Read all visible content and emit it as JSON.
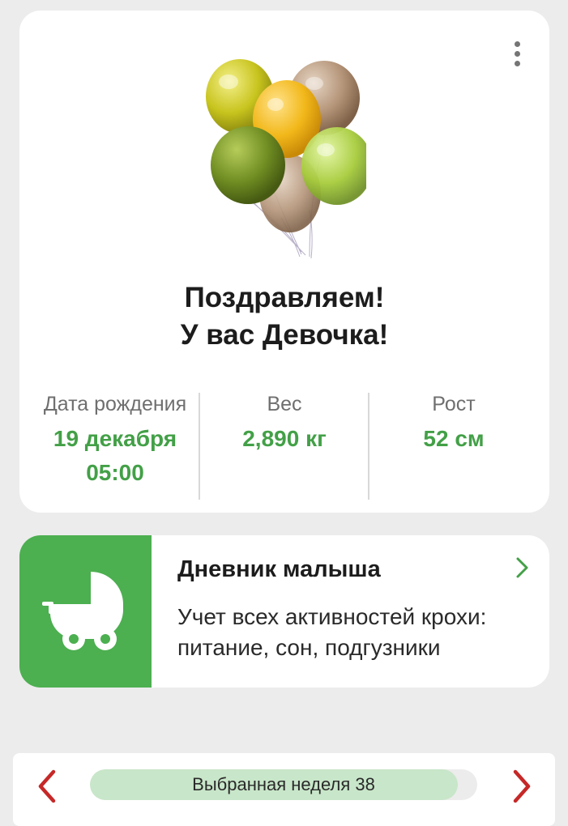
{
  "congrats": {
    "line1": "Поздравляем!",
    "line2": "У вас Девочка!",
    "menu_icon": "more-vertical-icon",
    "image": "balloons-illustration",
    "balloon_colors": [
      "#c8c41e",
      "#f2b81a",
      "#b49478",
      "#6f8d22",
      "#a7cc3c"
    ],
    "stats": {
      "date_label": "Дата рождения",
      "date_value": "19 декабря",
      "time_value": "05:00",
      "weight_label": "Вес",
      "weight_value": "2,890 кг",
      "height_label": "Рост",
      "height_value": "52 см"
    }
  },
  "diary": {
    "title": "Дневник малыша",
    "description": "Учет всех активностей крохи: питание, сон, подгузники",
    "icon": "baby-stroller-icon",
    "chevron_icon": "chevron-right-icon"
  },
  "week": {
    "label": "Выбранная неделя 38",
    "selected_week": 38,
    "progress_fraction": 0.95,
    "prev_icon": "chevron-left-icon",
    "next_icon": "chevron-right-icon"
  },
  "colors": {
    "accent_green": "#43a047",
    "icon_box_green": "#4caf50",
    "nav_red": "#c62828",
    "progress_fill": "#c8e6c9"
  }
}
